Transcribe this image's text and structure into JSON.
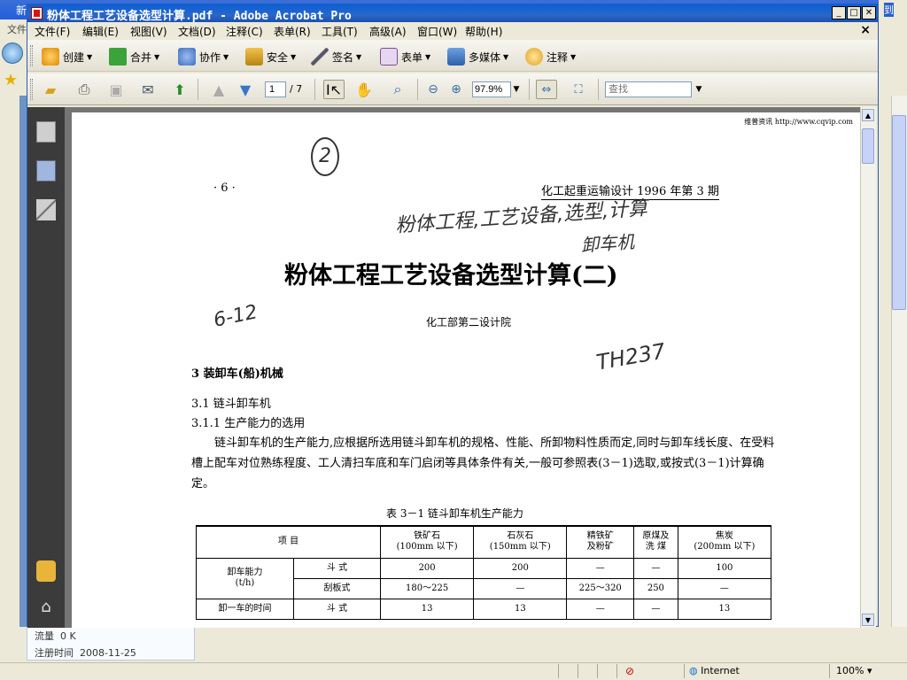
{
  "bg": {
    "title": "新",
    "menu_file": "文件",
    "info_flow_label": "流量",
    "info_flow_value": "0 K",
    "info_reg_label": "注册时间",
    "info_reg_value": "2008-11-25",
    "status_internet": "Internet",
    "status_zoom": "100%",
    "right_corner": "到"
  },
  "acrobat": {
    "title": "粉体工程工艺设备选型计算.pdf - Adobe Acrobat Pro",
    "menu": [
      "文件(F)",
      "编辑(E)",
      "视图(V)",
      "文档(D)",
      "注释(C)",
      "表单(R)",
      "工具(T)",
      "高级(A)",
      "窗口(W)",
      "帮助(H)"
    ],
    "toolbar1": [
      "创建",
      "合并",
      "协作",
      "安全",
      "签名",
      "表单",
      "多媒体",
      "注释"
    ],
    "page_current": "1",
    "page_total": "/ 7",
    "zoom": "97.9%",
    "find_placeholder": "查找"
  },
  "page": {
    "header_small": "维普资讯 http://www.cqvip.com",
    "page_num": "· 6 ·",
    "journal": "化工起重运输设计   1996 年第 3 期",
    "title": "粉体工程工艺设备选型计算(二)",
    "author": "化工部第二设计院",
    "sec3": "3   装卸车(船)机械",
    "sec31": "3.1   链斗卸车机",
    "sec311": "3.1.1   生产能力的选用",
    "para": "链斗卸车机的生产能力,应根据所选用链斗卸车机的规格、性能、所卸物料性质而定,同时与卸车线长度、在受料槽上配车对位熟练程度、工人清扫车底和车门启闭等具体条件有关,一般可参照表(3－1)选取,或按式(3－1)计算确定。",
    "table_title": "表 3－1   链斗卸车机生产能力",
    "table": {
      "h_item": "项     目",
      "h_cols": [
        "铁矿石\n(100mm 以下)",
        "石灰石\n(150mm 以下)",
        "精铁矿\n及粉矿",
        "原煤及\n洗   煤",
        "焦炭\n(200mm 以下)"
      ],
      "r1_label": "卸车能力\n(t/h)",
      "r1_sub": "斗   式",
      "r1_vals": [
        "200",
        "200",
        "—",
        "—",
        "100"
      ],
      "r2_sub": "刮板式",
      "r2_vals": [
        "180～225",
        "—",
        "225～320",
        "250",
        "—"
      ],
      "r3_label": "卸一车的时间",
      "r3_sub": "斗   式",
      "r3_vals": [
        "13",
        "13",
        "—",
        "—",
        "13"
      ]
    },
    "handwriting": {
      "circle_num": "2",
      "line1": "粉体工程,工艺设备,选型,计算",
      "line2": "卸车机",
      "left_note": "6-12",
      "right_note": "TH237"
    }
  }
}
